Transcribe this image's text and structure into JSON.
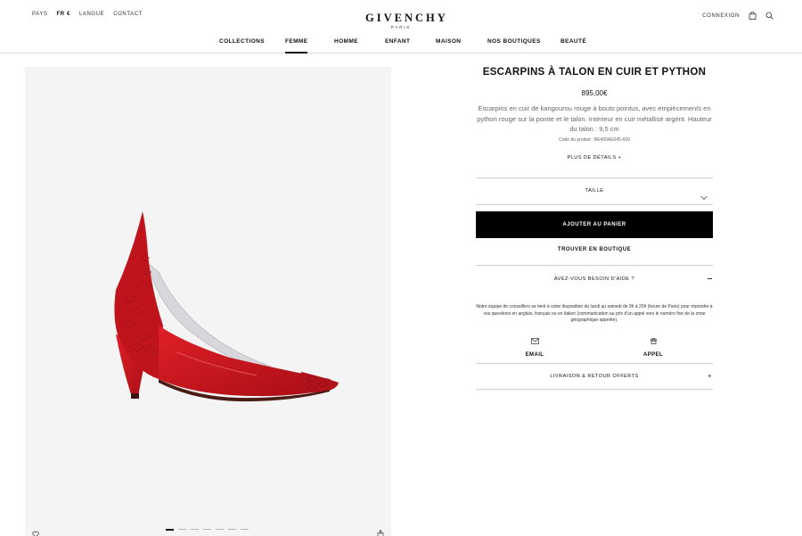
{
  "header": {
    "left_links": [
      "PAYS",
      "FR €",
      "LANGUE",
      "CONTACT"
    ],
    "brand": "GIVENCHY",
    "brand_sub": "PARIS",
    "connexion": "CONNEXION"
  },
  "nav": {
    "items": [
      "COLLECTIONS",
      "FEMME",
      "HOMME",
      "ENFANT",
      "MAISON",
      "NOS BOUTIQUES",
      "BEAUTÉ"
    ],
    "active": "FEMME"
  },
  "gallery": {
    "image_description": "Red leather pump with python panels",
    "slide_count": 7,
    "active_slide": 1
  },
  "product": {
    "title": "ESCARPINS À TALON EN CUIR ET PYTHON",
    "price": "895,00€",
    "description": "Escarpins en cuir de kangourou rouge à bouts pointus, avec empiècements en python rouge sur la pointe et le talon. Intérieur en cuir métallisé argent. Hauteur du talon : 9,5 cm",
    "code": "Code du produit : BE400AE045-600",
    "more_details": "PLUS DE DÉTAILS  +",
    "size_label": "TAILLE",
    "add_to_cart": "AJOUTER AU PANIER",
    "find_store": "TROUVER EN BOUTIQUE",
    "help_label": "AVEZ-VOUS BESOIN D'AIDE ?",
    "help_text": "Notre équipe de conseillers se tient à votre disposition du lundi au samedi de 9h à 20h (heure de Paris) pour répondre à vos questions en anglais, français ou en italien (communication au prix d'un appel vers le numéro fixe de la zone géographique appelée).",
    "email_label": "EMAIL",
    "call_label": "APPEL",
    "delivery_label": "LIVRAISON & RETOUR OFFERTS"
  },
  "colors": {
    "accent": "#000000",
    "shoe_red": "#c8141c",
    "media_bg": "#f4f4f4"
  }
}
